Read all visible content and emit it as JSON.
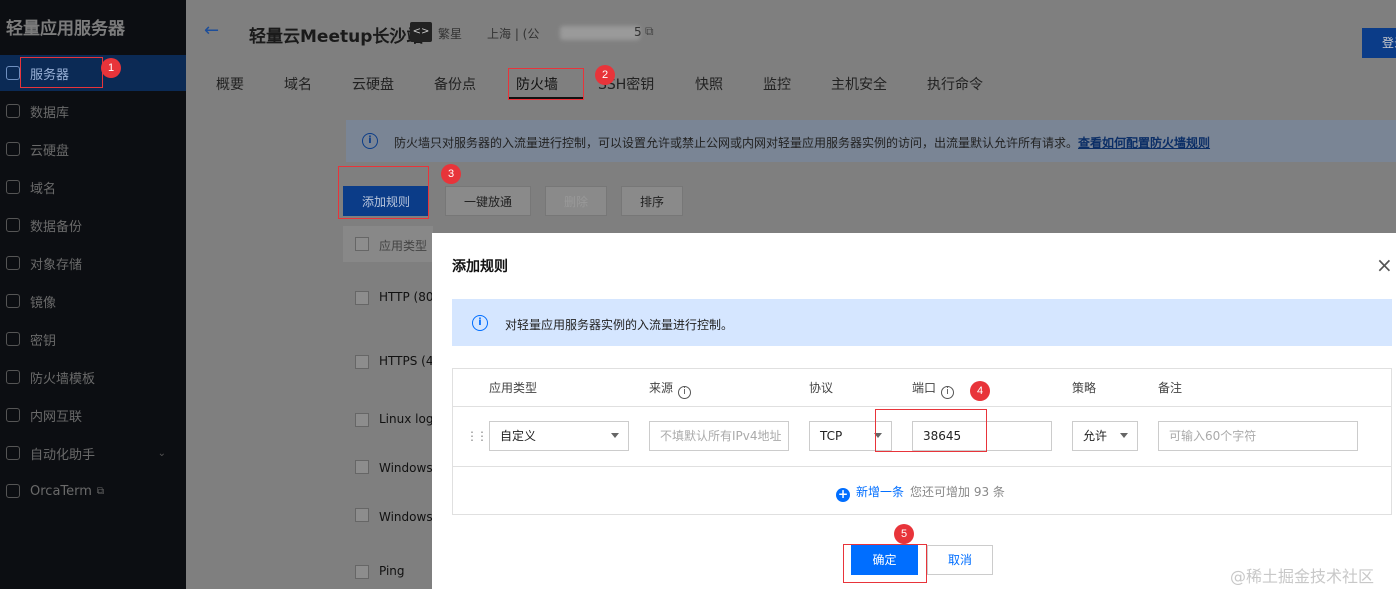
{
  "sidebar": {
    "brand": "轻量应用服务器",
    "items": [
      {
        "label": "服务器",
        "icon": "cube-icon",
        "active": true
      },
      {
        "label": "数据库",
        "icon": "database-icon"
      },
      {
        "label": "云硬盘",
        "icon": "disk-icon"
      },
      {
        "label": "域名",
        "icon": "domain-icon"
      },
      {
        "label": "数据备份",
        "icon": "backup-icon"
      },
      {
        "label": "对象存储",
        "icon": "storage-icon"
      },
      {
        "label": "镜像",
        "icon": "image-icon"
      },
      {
        "label": "密钥",
        "icon": "key-icon"
      },
      {
        "label": "防火墙模板",
        "icon": "shield-icon"
      },
      {
        "label": "内网互联",
        "icon": "network-icon"
      },
      {
        "label": "自动化助手",
        "icon": "automation-icon"
      },
      {
        "label": "OrcaTerm",
        "icon": "terminal-icon"
      }
    ]
  },
  "header": {
    "back_icon": "←",
    "instance_name": "轻量云Meetup长沙站",
    "logo_text": "<>",
    "flavor": "繁星",
    "region": "上海 | (公",
    "ip_tail": "5",
    "copy_icon": "⧉",
    "login_label": "登录"
  },
  "tabs": [
    "概要",
    "域名",
    "云硬盘",
    "备份点",
    "防火墙",
    "SSH密钥",
    "快照",
    "监控",
    "主机安全",
    "执行命令"
  ],
  "firewall": {
    "info_text": "防火墙只对服务器的入流量进行控制，可以设置允许或禁止公网或内网对轻量应用服务器实例的访问，出流量默认允许所有请求。",
    "info_link": "查看如何配置防火墙规则",
    "toolbar": {
      "add": "添加规则",
      "open_all": "一键放通",
      "delete": "删除",
      "sort": "排序"
    },
    "col_app_type": "应用类型",
    "rows": [
      "HTTP (80",
      "HTTPS (4",
      "Linux logi",
      "Windows登",
      "Windows登",
      "Ping"
    ]
  },
  "modal": {
    "title": "添加规则",
    "close_icon": "×",
    "info_text": "对轻量应用服务器实例的入流量进行控制。",
    "columns": {
      "app_type": "应用类型",
      "source": "来源",
      "protocol": "协议",
      "port": "端口",
      "policy": "策略",
      "remark": "备注"
    },
    "row": {
      "app_type": "自定义",
      "source_placeholder": "不填默认所有IPv4地址",
      "protocol": "TCP",
      "port": "38645",
      "policy": "允许",
      "remark_placeholder": "可输入60个字符"
    },
    "add_more_link": "新增一条",
    "add_more_hint": "您还可增加 93 条",
    "ok_label": "确定",
    "cancel_label": "取消"
  },
  "annotations": {
    "badge1": "1",
    "badge2": "2",
    "badge3": "3",
    "badge4": "4",
    "badge5": "5"
  },
  "watermark": "@稀土掘金技术社区",
  "colors": {
    "primary": "#006eff",
    "annotation": "#e8343a",
    "sidebar_bg": "#0c0e12"
  }
}
